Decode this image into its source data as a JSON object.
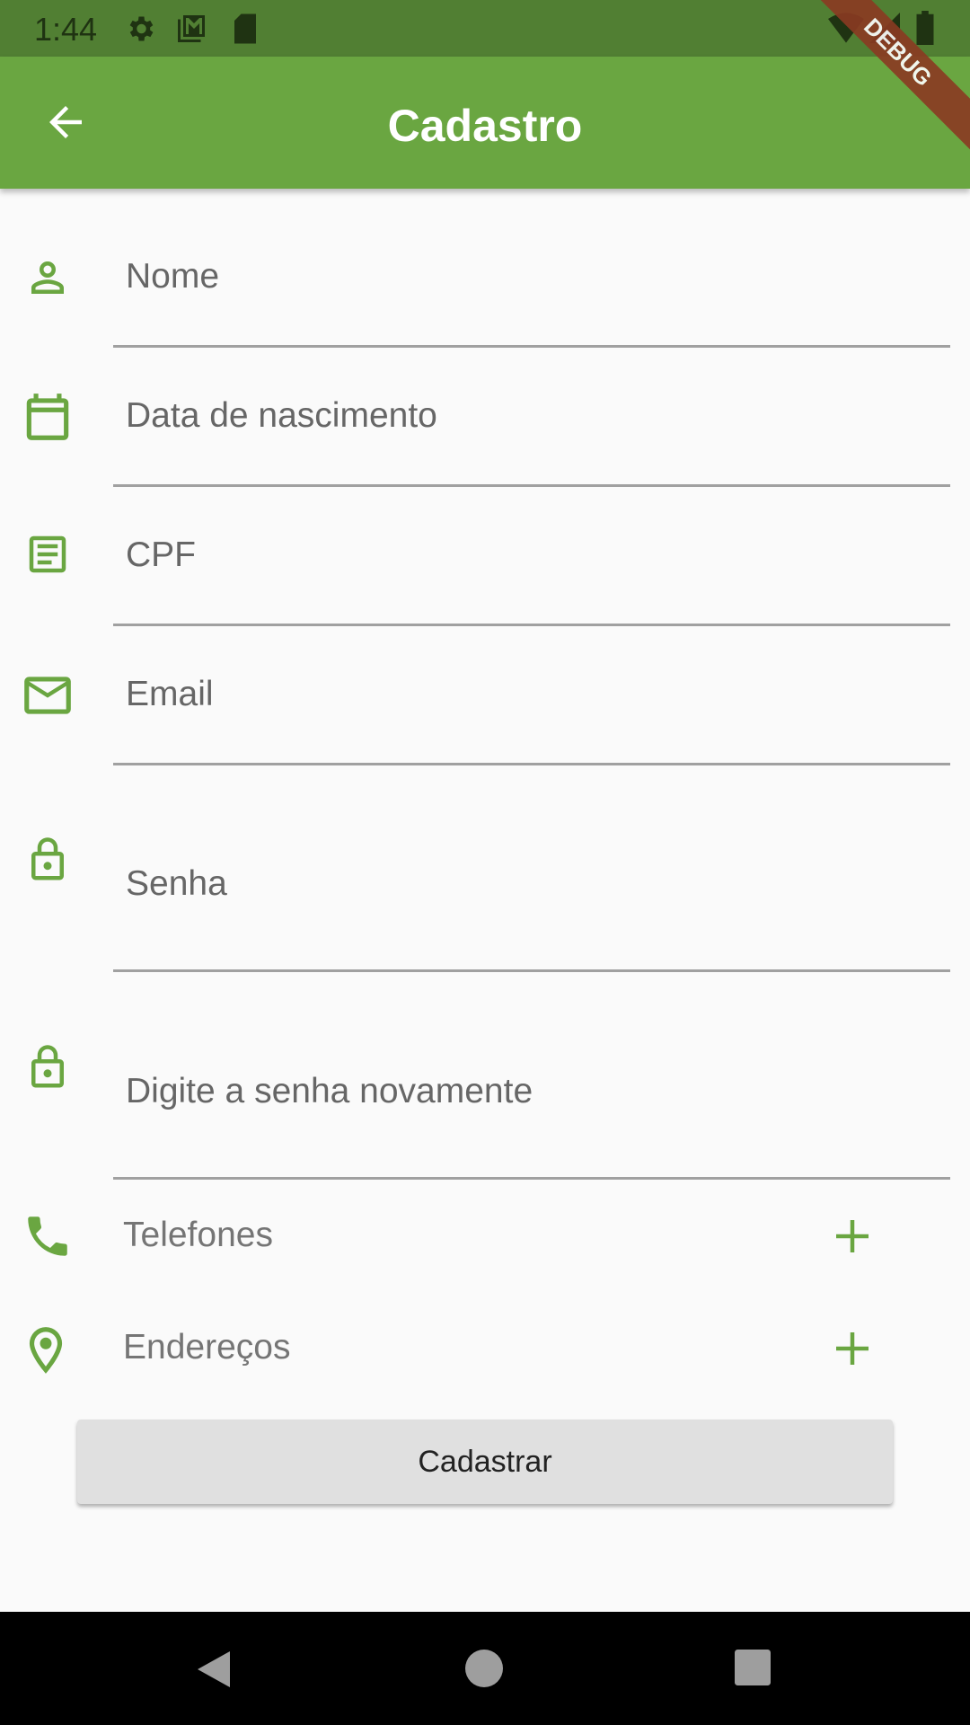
{
  "status_bar": {
    "time": "1:44",
    "icons": [
      "gear-icon",
      "gmail-icon",
      "sd-card-icon",
      "wifi-icon",
      "signal-icon",
      "battery-icon"
    ]
  },
  "app_bar": {
    "title": "Cadastro",
    "back_icon": "arrow-back-icon"
  },
  "debug_banner": "DEBUG",
  "fields": [
    {
      "hint": "Nome",
      "icon": "person-icon"
    },
    {
      "hint": "Data de nascimento",
      "icon": "calendar-icon"
    },
    {
      "hint": "CPF",
      "icon": "document-icon"
    },
    {
      "hint": "Email",
      "icon": "mail-icon"
    },
    {
      "hint": "Senha",
      "icon": "lock-icon"
    },
    {
      "hint": "Digite a senha novamente",
      "icon": "lock-icon"
    }
  ],
  "sections": [
    {
      "label": "Telefones",
      "icon": "phone-icon",
      "action_icon": "add-icon"
    },
    {
      "label": "Endereços",
      "icon": "location-pin-icon",
      "action_icon": "add-icon"
    }
  ],
  "submit_label": "Cadastrar",
  "colors": {
    "primary": "#6aa641",
    "status_bar": "#517f33",
    "icon": "#6aa641"
  }
}
